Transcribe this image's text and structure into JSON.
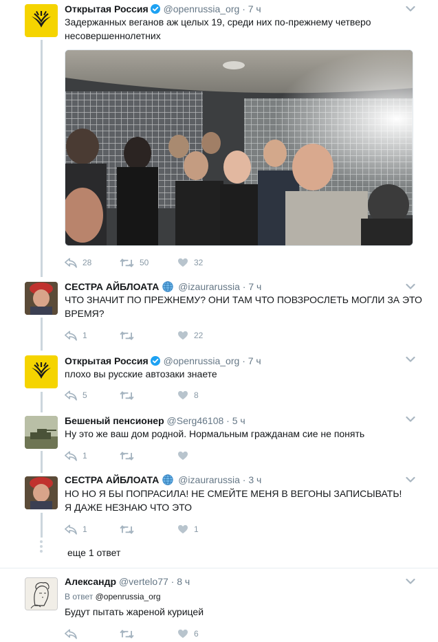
{
  "tweets": [
    {
      "name": "Открытая Россия",
      "handle": "@openrussia_org",
      "time": "7 ч",
      "text": "Задержанных веганов аж целых 19, среди них по-прежнему четверо несовершеннолетних",
      "replies": "28",
      "retweets": "50",
      "likes": "32"
    },
    {
      "name": "СЕСТРА АЙБЛОАТА",
      "handle": "@izaurarussia",
      "time": "7 ч",
      "text": "ЧТО ЗНАЧИТ ПО ПРЕЖНЕМУ? ОНИ ТАМ ЧТО ПОВЗРОСЛЕТЬ МОГЛИ ЗА ЭТО ВРЕМЯ?",
      "replies": "1",
      "retweets": "",
      "likes": "22"
    },
    {
      "name": "Открытая Россия",
      "handle": "@openrussia_org",
      "time": "7 ч",
      "text": "плохо вы русские автозаки знаете",
      "replies": "5",
      "retweets": "",
      "likes": "8"
    },
    {
      "name": "Бешеный пенсионер",
      "handle": "@Serg46108",
      "time": "5 ч",
      "text": "Ну это же ваш дом родной. Нормальным гражданам сие не понять",
      "replies": "1",
      "retweets": "",
      "likes": ""
    },
    {
      "name": "СЕСТРА АЙБЛОАТА",
      "handle": "@izaurarussia",
      "time": "3 ч",
      "text": "НО НО Я БЫ ПОПРАСИЛА! НЕ СМЕЙТЕ МЕНЯ В ВЕГОНЫ ЗАПИСЫВАТЬ! Я ДАЖЕ НЕЗНАЮ ЧТО ЭТО",
      "replies": "1",
      "retweets": "",
      "likes": "1"
    },
    {
      "name": "Александр",
      "handle": "@vertelo77",
      "time": "8 ч",
      "reply_prefix": "В ответ",
      "reply_handle": "@openrussia_org",
      "text": "Будут пытать жареной курицей",
      "replies": "",
      "retweets": "",
      "likes": "6"
    }
  ],
  "more_replies": "еще 1 ответ",
  "colors": {
    "accent_yellow": "#f5d400",
    "verified_blue": "#1da1f2",
    "muted": "#657786",
    "thread_line": "#ccd6dd"
  },
  "icons": [
    "reply-icon",
    "retweet-icon",
    "like-icon",
    "verified-icon",
    "globe-icon",
    "caret-down-icon"
  ]
}
